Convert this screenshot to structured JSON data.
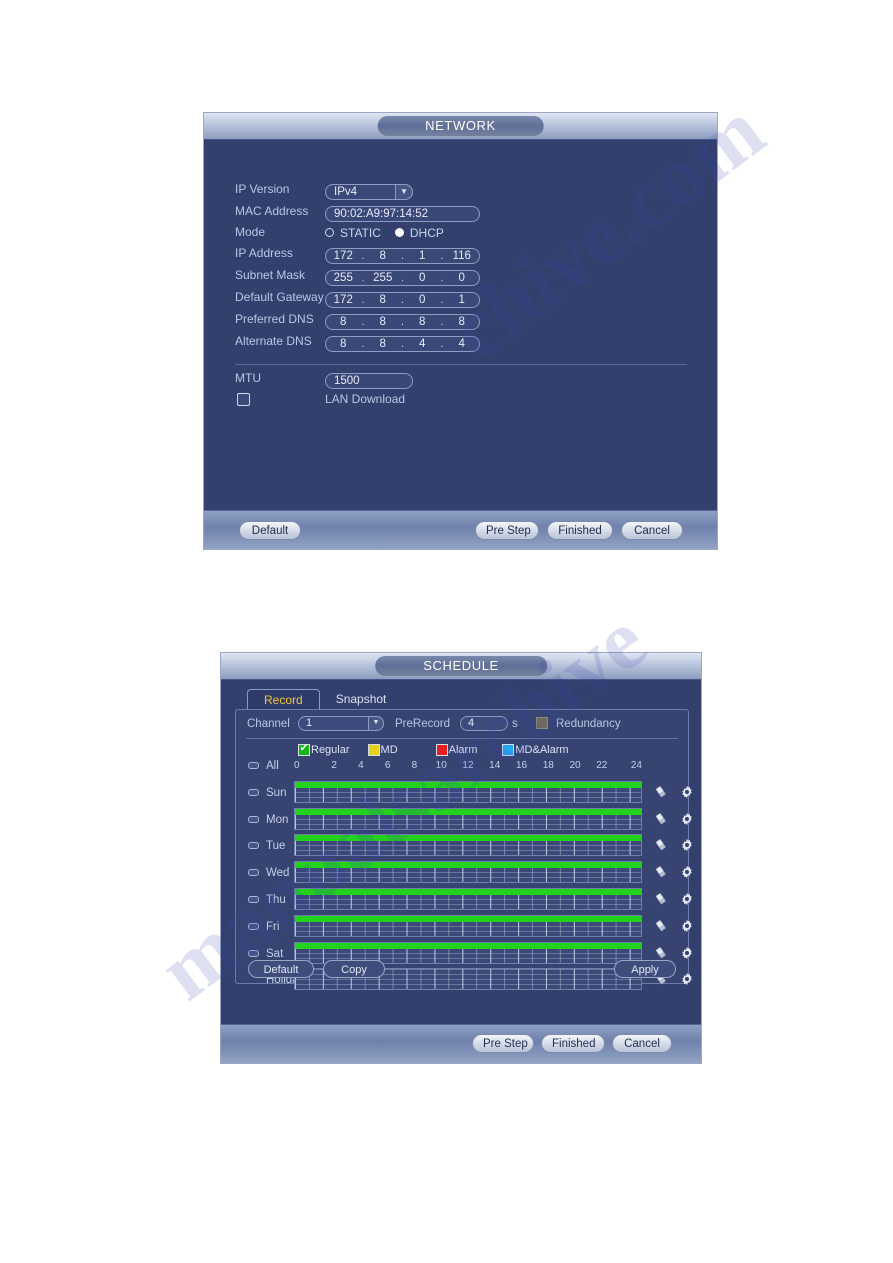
{
  "watermark": {
    "line1": "chive.com",
    "line2": "manualsarchive"
  },
  "network_dialog": {
    "title": "NETWORK",
    "fields": {
      "ip_version_label": "IP Version",
      "ip_version_value": "IPv4",
      "mac_label": "MAC Address",
      "mac_value": "90:02:A9:97:14:52",
      "mode_label": "Mode",
      "mode_static": "STATIC",
      "mode_dhcp": "DHCP",
      "mode_selected": "DHCP",
      "ip_address_label": "IP Address",
      "ip_address": [
        "172",
        "8",
        "1",
        "116"
      ],
      "subnet_label": "Subnet Mask",
      "subnet": [
        "255",
        "255",
        "0",
        "0"
      ],
      "gateway_label": "Default Gateway",
      "gateway": [
        "172",
        "8",
        "0",
        "1"
      ],
      "preferred_dns_label": "Preferred DNS",
      "preferred_dns": [
        "8",
        "8",
        "8",
        "8"
      ],
      "alternate_dns_label": "Alternate DNS",
      "alternate_dns": [
        "8",
        "8",
        "4",
        "4"
      ],
      "mtu_label": "MTU",
      "mtu_value": "1500",
      "lan_download_label": "LAN Download",
      "lan_download_checked": false
    },
    "buttons": {
      "default": "Default",
      "pre_step": "Pre Step",
      "finished": "Finished",
      "cancel": "Cancel"
    }
  },
  "schedule_dialog": {
    "title": "SCHEDULE",
    "tabs": [
      {
        "label": "Record",
        "active": true
      },
      {
        "label": "Snapshot",
        "active": false
      }
    ],
    "channel_label": "Channel",
    "channel_value": "1",
    "prerecord_label": "PreRecord",
    "prerecord_value": "4",
    "prerecord_unit": "s",
    "redundancy_label": "Redundancy",
    "redundancy_checked": false,
    "legend": [
      {
        "label": "Regular",
        "color": "#19b419",
        "checked": true
      },
      {
        "label": "MD",
        "color": "#e5d218",
        "checked": false
      },
      {
        "label": "Alarm",
        "color": "#e81e1e",
        "checked": false
      },
      {
        "label": "MD&Alarm",
        "color": "#23a9f2",
        "checked": false
      }
    ],
    "hour_ticks": [
      "0",
      "2",
      "4",
      "6",
      "8",
      "10",
      "12",
      "14",
      "16",
      "18",
      "20",
      "22",
      "24"
    ],
    "rows": [
      {
        "name": "All",
        "toggle": true,
        "filled": false,
        "icons": false
      },
      {
        "name": "Sun",
        "toggle": true,
        "filled": true,
        "icons": true
      },
      {
        "name": "Mon",
        "toggle": true,
        "filled": true,
        "icons": true
      },
      {
        "name": "Tue",
        "toggle": true,
        "filled": true,
        "icons": true
      },
      {
        "name": "Wed",
        "toggle": true,
        "filled": true,
        "icons": true
      },
      {
        "name": "Thu",
        "toggle": true,
        "filled": true,
        "icons": true
      },
      {
        "name": "Fri",
        "toggle": true,
        "filled": true,
        "icons": true
      },
      {
        "name": "Sat",
        "toggle": true,
        "filled": true,
        "icons": true
      },
      {
        "name": "Holiday",
        "toggle": false,
        "filled": false,
        "icons": true
      }
    ],
    "buttons": {
      "default": "Default",
      "copy": "Copy",
      "apply": "Apply",
      "pre_step": "Pre Step",
      "finished": "Finished",
      "cancel": "Cancel"
    }
  }
}
